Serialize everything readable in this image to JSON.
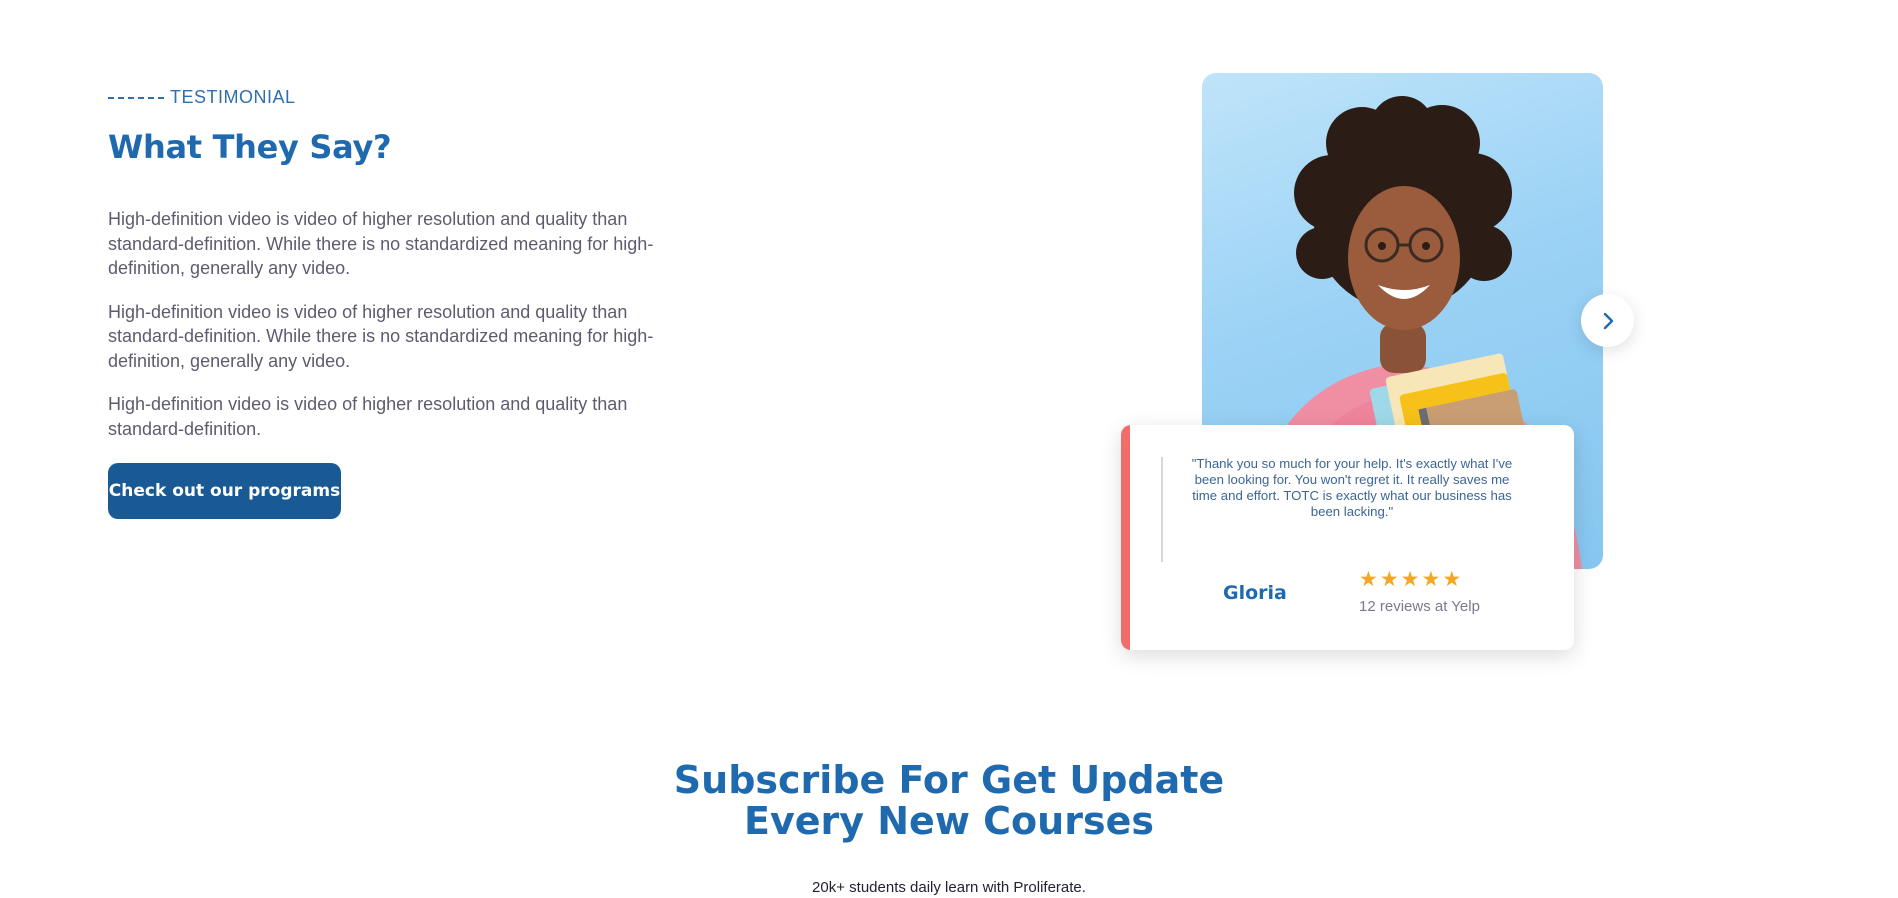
{
  "testimonial": {
    "eyebrow": "TESTIMONIAL",
    "title": "What They Say?",
    "paragraphs": [
      "High-definition video is video of higher resolution and quality than standard-definition. While there is no standardized meaning for high-definition, generally any video.",
      "High-definition video is video of higher resolution and quality than standard-definition. While there is no standardized meaning for high-definition, generally any video.",
      "High-definition video is video of higher resolution and quality than standard-definition."
    ],
    "cta_label": "Check out our programs",
    "next_icon": "chevron-right-icon",
    "card": {
      "quote": "\"Thank you so much for your help. It's exactly what I've been looking for. You won't regret it. It really saves me time and effort. TOTC is exactly what our business has been lacking.\"",
      "name": "Gloria",
      "rating": 5,
      "reviews": "12 reviews at Yelp"
    }
  },
  "subscribe": {
    "title_line1": "Subscribe For Get Update",
    "title_line2": "Every New Courses",
    "subtitle": "20k+ students daily learn with Proliferate."
  },
  "colors": {
    "brand_blue": "#1F6AAE",
    "button_blue": "#1A5A94",
    "accent_red": "#F26C6C",
    "star_orange": "#F5A623",
    "photo_bg": "#9BD2F5"
  }
}
